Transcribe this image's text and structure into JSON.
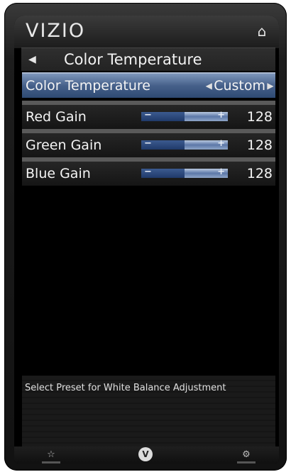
{
  "header": {
    "logo_text": "VIZIO",
    "home_icon": "home-icon"
  },
  "breadcrumb": {
    "back_icon": "back-arrow-icon",
    "title": "Color Temperature"
  },
  "menu": {
    "color_temperature": {
      "label": "Color Temperature",
      "value": "Custom"
    },
    "red_gain": {
      "label": "Red Gain",
      "value": "128",
      "level": 0.5
    },
    "green_gain": {
      "label": "Green Gain",
      "value": "128",
      "level": 0.5
    },
    "blue_gain": {
      "label": "Blue Gain",
      "value": "128",
      "level": 0.5
    }
  },
  "help": {
    "text": "Select Preset for White Balance Adjustment"
  },
  "footer": {
    "left_icon": "star-icon",
    "center_icon": "vizio-v-icon",
    "right_icon": "gear-icon"
  },
  "colors": {
    "selected_row": "#46608a",
    "background": "#000000",
    "text": "#f4f4f4"
  }
}
